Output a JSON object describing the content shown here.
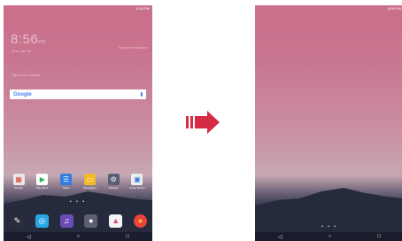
{
  "left_screen": {
    "status_time": "8:56 PM",
    "clock_time": "8:56",
    "clock_ampm": "PM",
    "date": "Mon, Jan 30",
    "weather": "Tap to set weather",
    "location_text": "Tap to set location",
    "search_logo": "Google",
    "apps": [
      {
        "label": "Google",
        "icon": "google-apps-icon",
        "color": "#e8e8e8"
      },
      {
        "label": "Play Store",
        "icon": "play-store-icon",
        "color": "#ffffff"
      },
      {
        "label": "Tasks",
        "icon": "tasks-icon",
        "color": "#2f7de1"
      },
      {
        "label": "Messaging",
        "icon": "messaging-icon",
        "color": "#f3b928"
      },
      {
        "label": "Settings",
        "icon": "settings-icon",
        "color": "#5a5e72"
      },
      {
        "label": "Smart Doctor",
        "icon": "smart-doctor-icon",
        "color": "#e9eef3"
      }
    ],
    "page_indicator": "• • •",
    "dock_icons": [
      "pen-icon",
      "browser-icon",
      "music-icon",
      "camera-icon",
      "gallery-icon",
      "chrome-icon"
    ],
    "nav": {
      "back": "◁",
      "home": "○",
      "recents": "□"
    }
  },
  "right_screen": {
    "status_time": "8:56 PM",
    "page_indicator": "• • •",
    "nav": {
      "back": "◁",
      "home": "○",
      "recents": "□"
    }
  },
  "colors": {
    "arrow": "#d62b45",
    "wallpaper_top": "#cb6f8a",
    "nav_bar": "#1a1d2b"
  }
}
